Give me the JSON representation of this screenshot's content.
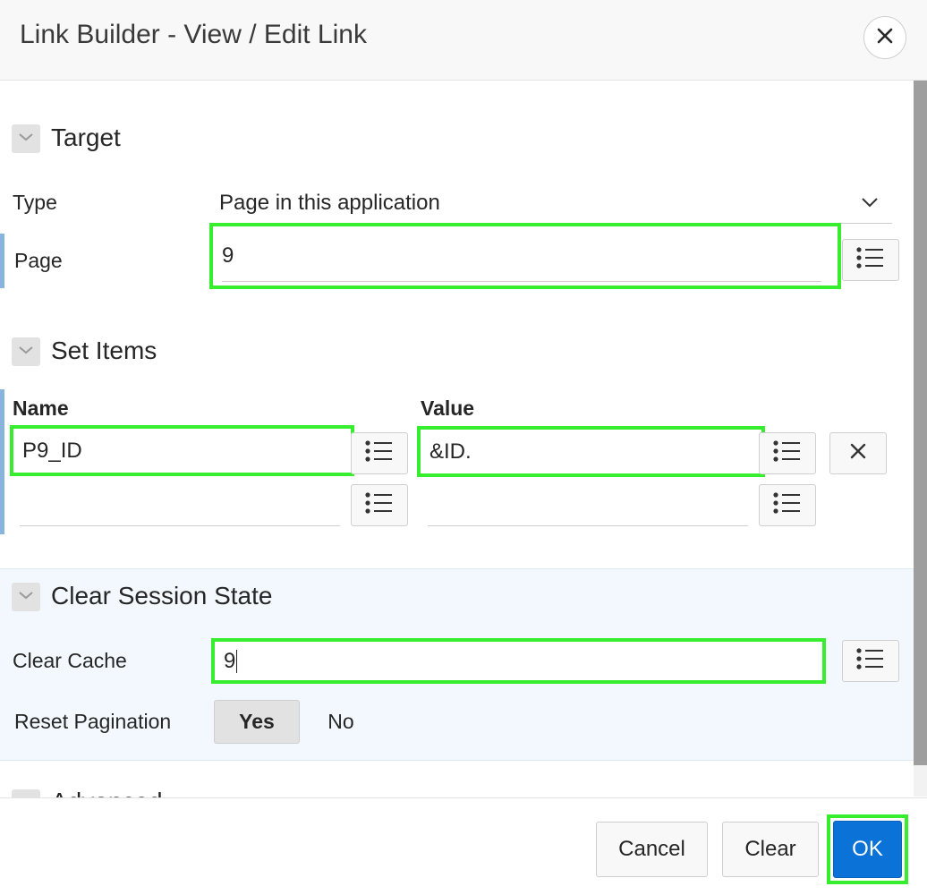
{
  "dialog": {
    "title": "Link Builder - View / Edit Link",
    "close_icon": "close-icon"
  },
  "target": {
    "section_title": "Target",
    "type_label": "Type",
    "type_value": "Page in this application",
    "page_label": "Page",
    "page_value": "9"
  },
  "set_items": {
    "section_title": "Set Items",
    "name_header": "Name",
    "value_header": "Value",
    "rows": [
      {
        "name": "P9_ID",
        "value": "&ID."
      },
      {
        "name": "",
        "value": ""
      }
    ]
  },
  "clear_session": {
    "section_title": "Clear Session State",
    "clear_cache_label": "Clear Cache",
    "clear_cache_value": "9",
    "reset_pagination_label": "Reset Pagination",
    "yes_label": "Yes",
    "no_label": "No",
    "reset_pagination_selected": "Yes"
  },
  "advanced": {
    "section_title": "Advanced"
  },
  "footer": {
    "cancel_label": "Cancel",
    "clear_label": "Clear",
    "ok_label": "OK"
  },
  "colors": {
    "highlight": "#36ee2e",
    "primary": "#0b72d8",
    "field_accent": "#87b5de"
  }
}
